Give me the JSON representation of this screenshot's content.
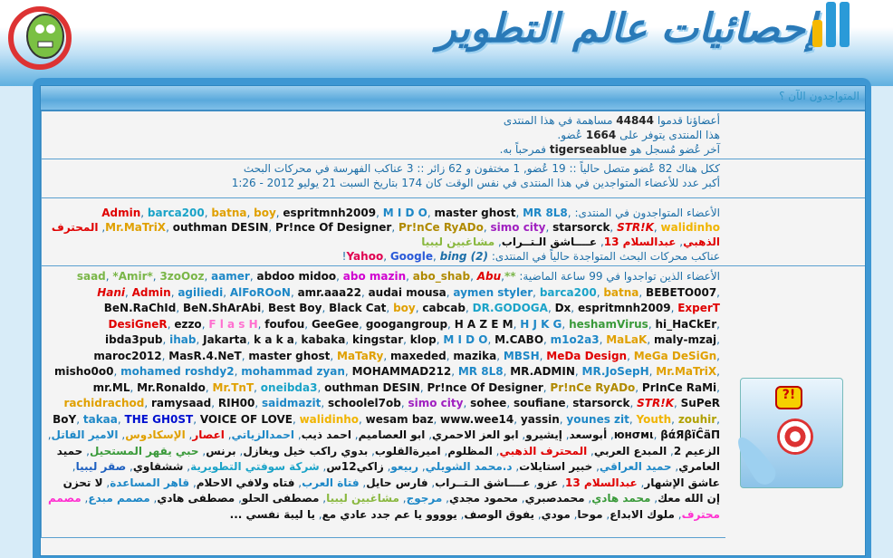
{
  "header": {
    "logo_text": "إحصائيات عالم التطوير",
    "bar_colors": [
      "#f5b800",
      "#2a9ad8",
      "#2a9ad8"
    ]
  },
  "panel": {
    "title": "المتواجدون الآن ؟"
  },
  "stats": {
    "posts_pre": "أعضاؤنا قدموا",
    "posts": "44844",
    "posts_post": "مساهمة في هذا المنتدى",
    "members_pre": "هذا المنتدى يتوفر على",
    "members": "1664",
    "members_post": "عُضو.",
    "last_pre": "آخر عُضو مُسجل هو",
    "last": "tigerseablue",
    "last_post": "فمرحباً به."
  },
  "online": {
    "line1": "ككل هناك 82 عُضو متصل حالياً :: 19 عُضو, 1 مختفون و 62 زائر :: 3 عناكب الفهرسة في محركات البحث",
    "line2": "أكبر عدد للأعضاء المتواجدين في هذا المنتدى في نفس الوقت كان 174 بتاريخ السبت 21 يوليو 2012 - 1:26",
    "members_label": "الأعضاء المتواجدون في المنتدى:",
    "members": [
      {
        "n": "Admin",
        "c": "#e00000"
      },
      {
        "n": "barca200",
        "c": "#1aa3c8"
      },
      {
        "n": "batna",
        "c": "#e0a000"
      },
      {
        "n": "boy",
        "c": "#e0a000"
      },
      {
        "n": "espritmnh2009",
        "c": "#111"
      },
      {
        "n": "M I D O",
        "c": "#1e88c7"
      },
      {
        "n": "master ghost",
        "c": "#111"
      },
      {
        "n": "MR 8L8",
        "c": "#1e88c7"
      },
      {
        "n": "Mr.MaTriX",
        "c": "#e0a000"
      },
      {
        "n": "outhman DESIN",
        "c": "#111"
      },
      {
        "n": "Pr!nce Of Designer",
        "c": "#111"
      },
      {
        "n": "Pr!nCe RyADo",
        "c": "#b08a00"
      },
      {
        "n": "simo city",
        "c": "#a020c0"
      },
      {
        "n": "starsorck",
        "c": "#111"
      },
      {
        "n": "STR!K",
        "c": "#e00000",
        "i": true
      },
      {
        "n": "walidinho",
        "c": "#f0b400"
      },
      {
        "n": "المحترف الذهبي",
        "c": "#e00000"
      },
      {
        "n": "عبدالسلام 13",
        "c": "#e00000"
      },
      {
        "n": "عــــاشق الـتــراب",
        "c": "#111"
      },
      {
        "n": "مشاغبين ليبيا",
        "c": "#8ab840"
      }
    ],
    "bots_label": "عناكب محركات البحث المتواجدة حالياً في المنتدى:",
    "bots": [
      {
        "n": "Yahoo",
        "c": "#e00050"
      },
      {
        "n": "Google",
        "c": "#2a5ad8"
      },
      {
        "n": "bing (2)",
        "c": "#1d6fa8",
        "i": true
      }
    ],
    "bots_suffix": "!"
  },
  "recent": {
    "label": "الأعضاء الذين تواجدوا في 99 ساعة الماضية:",
    "members": [
      {
        "n": "**saad",
        "c": "#7ab648"
      },
      {
        "n": "*Amir*",
        "c": "#7ab648"
      },
      {
        "n": "3zoOoz",
        "c": "#7ab648"
      },
      {
        "n": "aamer",
        "c": "#1e88c7"
      },
      {
        "n": "abdoo midoo",
        "c": "#111"
      },
      {
        "n": "abo mazin",
        "c": "#d000d0"
      },
      {
        "n": "abo_shab",
        "c": "#b08a00"
      },
      {
        "n": "Abu",
        "c": "#e00000",
        "i": true
      },
      {
        "n": "Hani",
        "c": "#e00000",
        "i": true
      },
      {
        "n": "Admin",
        "c": "#e00000"
      },
      {
        "n": "agiliedi",
        "c": "#1e88c7"
      },
      {
        "n": "AlFoROoN",
        "c": "#1e88c7"
      },
      {
        "n": "amr.aaa22",
        "c": "#111"
      },
      {
        "n": "audai mousa",
        "c": "#111"
      },
      {
        "n": "aymen styler",
        "c": "#1e88c7"
      },
      {
        "n": "barca200",
        "c": "#1aa3c8"
      },
      {
        "n": "batna",
        "c": "#e0a000"
      },
      {
        "n": "BEBETO007",
        "c": "#111"
      },
      {
        "n": "BeN.RaChId",
        "c": "#111"
      },
      {
        "n": "BeN.ShArAbi",
        "c": "#111"
      },
      {
        "n": "Best Boy",
        "c": "#111"
      },
      {
        "n": "Black Cat",
        "c": "#111"
      },
      {
        "n": "boy",
        "c": "#e0a000"
      },
      {
        "n": "cabcab",
        "c": "#111"
      },
      {
        "n": "DR.GODOGA",
        "c": "#1aa3c8"
      },
      {
        "n": "Dx",
        "c": "#111"
      },
      {
        "n": "espritmnh2009",
        "c": "#111"
      },
      {
        "n": "ExperT DesiGneR",
        "c": "#e00000"
      },
      {
        "n": "ezzo",
        "c": "#111"
      },
      {
        "n": "F l a s H",
        "c": "#ff70d0"
      },
      {
        "n": "foufou",
        "c": "#111"
      },
      {
        "n": "GeeGee",
        "c": "#111"
      },
      {
        "n": "googangroup",
        "c": "#111"
      },
      {
        "n": "H A Z E M",
        "c": "#111"
      },
      {
        "n": "H J K G",
        "c": "#1e88c7"
      },
      {
        "n": "heshamVirus",
        "c": "#3a9a3a"
      },
      {
        "n": "hi_HaCkEr",
        "c": "#111"
      },
      {
        "n": "ibda3pub",
        "c": "#111"
      },
      {
        "n": "ihab",
        "c": "#1e88c7"
      },
      {
        "n": "Jakarta",
        "c": "#111"
      },
      {
        "n": "k a k a",
        "c": "#111"
      },
      {
        "n": "kabaka",
        "c": "#111"
      },
      {
        "n": "kingstar",
        "c": "#111"
      },
      {
        "n": "klop",
        "c": "#111"
      },
      {
        "n": "M I D O",
        "c": "#1e88c7"
      },
      {
        "n": "M.CABO",
        "c": "#111"
      },
      {
        "n": "m1o2a3",
        "c": "#1e88c7"
      },
      {
        "n": "MaLaK",
        "c": "#e0a000"
      },
      {
        "n": "maly-mzaj",
        "c": "#111"
      },
      {
        "n": "maroc2012",
        "c": "#111"
      },
      {
        "n": "MasR.4.NeT",
        "c": "#111"
      },
      {
        "n": "master ghost",
        "c": "#111"
      },
      {
        "n": "MaTaRy",
        "c": "#e0a000"
      },
      {
        "n": "maxeded",
        "c": "#111"
      },
      {
        "n": "mazika",
        "c": "#111"
      },
      {
        "n": "MBSH",
        "c": "#1e88c7"
      },
      {
        "n": "MeDa Design",
        "c": "#e00000"
      },
      {
        "n": "MeGa DeSiGn",
        "c": "#e0a000"
      },
      {
        "n": "misho0o0",
        "c": "#111"
      },
      {
        "n": "mohamed roshdy2",
        "c": "#1e88c7"
      },
      {
        "n": "mohammad zyan",
        "c": "#1e88c7"
      },
      {
        "n": "MOHAMMAD212",
        "c": "#111"
      },
      {
        "n": "MR 8L8",
        "c": "#1e88c7"
      },
      {
        "n": "MR.ADMIN",
        "c": "#111"
      },
      {
        "n": "MR.JoSepH",
        "c": "#1e88c7"
      },
      {
        "n": "Mr.MaTriX",
        "c": "#e0a000"
      },
      {
        "n": "mr.ML",
        "c": "#111"
      },
      {
        "n": "Mr.Ronaldo",
        "c": "#111"
      },
      {
        "n": "Mr.TnT",
        "c": "#e0a000"
      },
      {
        "n": "oneibda3",
        "c": "#1aa3c8"
      },
      {
        "n": "outhman DESIN",
        "c": "#111"
      },
      {
        "n": "Pr!nce Of Designer",
        "c": "#111"
      },
      {
        "n": "Pr!nCe RyADo",
        "c": "#b08a00"
      },
      {
        "n": "PrInCe RaMi",
        "c": "#111"
      },
      {
        "n": "rachidrachod",
        "c": "#e0a000"
      },
      {
        "n": "ramysaad",
        "c": "#111"
      },
      {
        "n": "RIH00",
        "c": "#111"
      },
      {
        "n": "saidmazit",
        "c": "#1e88c7"
      },
      {
        "n": "schoolel7ob",
        "c": "#111"
      },
      {
        "n": "simo city",
        "c": "#a020c0"
      },
      {
        "n": "sohee",
        "c": "#111"
      },
      {
        "n": "soufiane",
        "c": "#111"
      },
      {
        "n": "starsorck",
        "c": "#111"
      },
      {
        "n": "STR!K",
        "c": "#e00000",
        "i": true
      },
      {
        "n": "SuPeR BoY",
        "c": "#111"
      },
      {
        "n": "takaa",
        "c": "#1e88c7"
      },
      {
        "n": "THE GH0ST",
        "c": "#0010d0"
      },
      {
        "n": "VOICE OF LOVE",
        "c": "#111"
      },
      {
        "n": "walidinho",
        "c": "#f0b400"
      },
      {
        "n": "wesam baz",
        "c": "#111"
      },
      {
        "n": "www.wee14",
        "c": "#111"
      },
      {
        "n": "yassin",
        "c": "#111"
      },
      {
        "n": "younes zit",
        "c": "#1e88c7"
      },
      {
        "n": "Youth",
        "c": "#f0b400"
      },
      {
        "n": "zouhir",
        "c": "#b0a000"
      },
      {
        "n": "юнσмι",
        "c": "#111"
      },
      {
        "n": "βάЯβïĈäΠ",
        "c": "#111"
      },
      {
        "n": "أبوسعد",
        "c": "#111"
      },
      {
        "n": "إيشيرو",
        "c": "#111"
      },
      {
        "n": "ابو العز الاحمري",
        "c": "#111"
      },
      {
        "n": "ابو العصاميم",
        "c": "#111"
      },
      {
        "n": "احمد ذيب",
        "c": "#111"
      },
      {
        "n": "احمدالزياتي",
        "c": "#1e88c7"
      },
      {
        "n": "اعصار",
        "c": "#e00000"
      },
      {
        "n": "الإسكادوس",
        "c": "#e0a000"
      },
      {
        "n": "الامير القاتل",
        "c": "#1e88c7"
      },
      {
        "n": "الزعيم 2",
        "c": "#111"
      },
      {
        "n": "المبدع العربي",
        "c": "#111"
      },
      {
        "n": "المحترف الذهبي",
        "c": "#e00000"
      },
      {
        "n": "المظلوم",
        "c": "#111"
      },
      {
        "n": "اميرةالقلوب",
        "c": "#111"
      },
      {
        "n": "بدوي راكب خيل ويغازل",
        "c": "#111"
      },
      {
        "n": "برنس",
        "c": "#111"
      },
      {
        "n": "حبي يقهر المستحيل",
        "c": "#3a9a3a"
      },
      {
        "n": "حميد العامري",
        "c": "#111"
      },
      {
        "n": "حميد العراقي",
        "c": "#1e88c7"
      },
      {
        "n": "خبير استايلات",
        "c": "#111"
      },
      {
        "n": "د.محمد الشويلي",
        "c": "#1e88c7"
      },
      {
        "n": "ربيعو",
        "c": "#1e88c7"
      },
      {
        "n": "زاكي12س",
        "c": "#111"
      },
      {
        "n": "شركة سوفتي التطويرية",
        "c": "#1aa3c8"
      },
      {
        "n": "ششقاوي",
        "c": "#111"
      },
      {
        "n": "صقر ليبيا",
        "c": "#1e60c0"
      },
      {
        "n": "عاشق الإشهار",
        "c": "#111"
      },
      {
        "n": "عبدالسلام 13",
        "c": "#e00000"
      },
      {
        "n": "عزو",
        "c": "#111"
      },
      {
        "n": "عــــاشق الـتــراب",
        "c": "#111"
      },
      {
        "n": "فارس حايل",
        "c": "#111"
      },
      {
        "n": "فتاة العرب",
        "c": "#1e88c7"
      },
      {
        "n": "فتاه ولافي الاحلام",
        "c": "#111"
      },
      {
        "n": "قاهر المساعدة",
        "c": "#1e88c7"
      },
      {
        "n": "لا تحزن إن الله معك",
        "c": "#111"
      },
      {
        "n": "محمد هادي",
        "c": "#3a9a3a"
      },
      {
        "n": "محمدصبري",
        "c": "#111"
      },
      {
        "n": "محمود مجدي",
        "c": "#111"
      },
      {
        "n": "مرجوج",
        "c": "#1e88c7"
      },
      {
        "n": "مشاغبين ليبيا",
        "c": "#8ab840"
      },
      {
        "n": "مصطفى الحلو",
        "c": "#111"
      },
      {
        "n": "مصطفى هادي",
        "c": "#111"
      },
      {
        "n": "مصمم مبدع",
        "c": "#1e88c7"
      },
      {
        "n": "مصمم محترف",
        "c": "#ff30d0"
      },
      {
        "n": "ملوك الابداع",
        "c": "#111"
      },
      {
        "n": "موحا",
        "c": "#111"
      },
      {
        "n": "مودي",
        "c": "#111"
      },
      {
        "n": "يفوق الوصف",
        "c": "#111"
      },
      {
        "n": "يوووو يا عم جدد عادي مع",
        "c": "#111"
      },
      {
        "n": "يا ليبهَ نفسي ...",
        "c": "#111"
      }
    ]
  }
}
